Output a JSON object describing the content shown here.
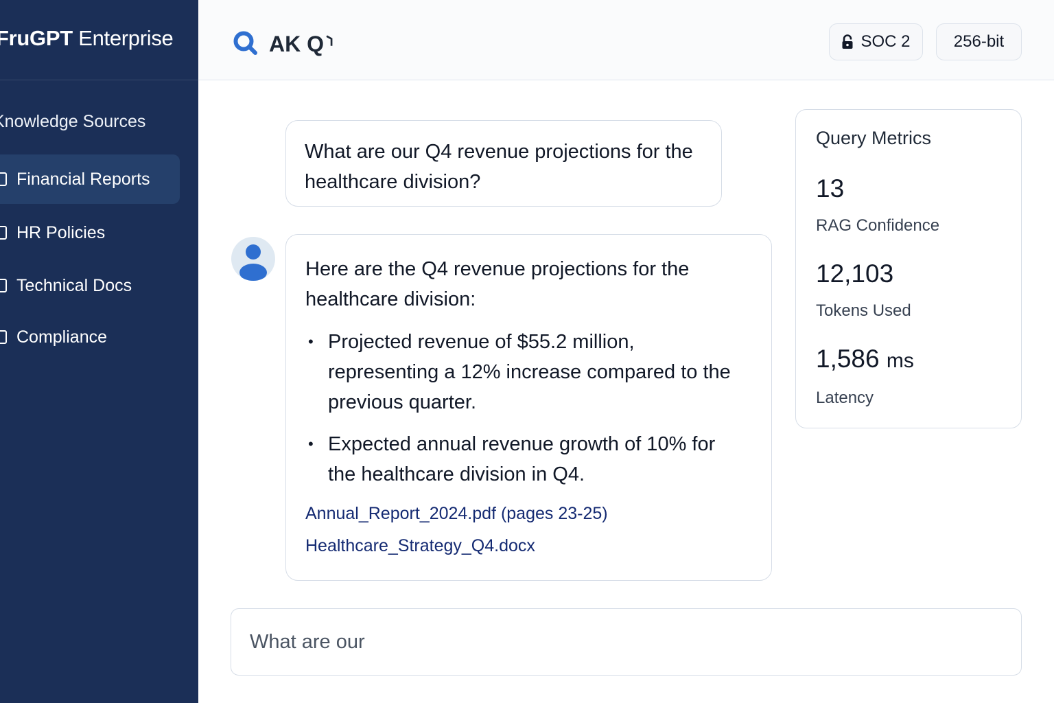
{
  "sidebar": {
    "brand_bold": "FruGPT",
    "brand_rest": " Enterprise",
    "section_title": "Knowledge Sources",
    "items": [
      {
        "label": "Financial Reports",
        "icon": "document-icon",
        "active": true
      },
      {
        "label": "HR Policies",
        "icon": "document-icon",
        "active": false
      },
      {
        "label": "Technical Docs",
        "icon": "document-icon",
        "active": false
      },
      {
        "label": "Compliance",
        "icon": "document-icon",
        "active": false
      }
    ]
  },
  "header": {
    "title": "AK Q⸃",
    "badges": [
      {
        "label": "SOC 2",
        "icon": "lock-icon"
      },
      {
        "label": "256-bit"
      }
    ]
  },
  "chat": {
    "user_message": "What are our Q4 revenue projections for the healthcare division?",
    "bot_intro": "Here are the Q4 revenue projections for the healthcare division:",
    "bot_bullets": [
      "Projected revenue of $55.2 million, representing a 12% increase compared to the previous quarter.",
      "Expected annual revenue growth of 10% for the healthcare division in Q4."
    ],
    "sources": [
      "Annual_Report_2024.pdf (pages 23-25)",
      "Healthcare_Strategy_Q4.docx"
    ]
  },
  "metrics": {
    "title": "Query Metrics",
    "items": [
      {
        "value": "13",
        "unit": "",
        "label": "RAG Confidence"
      },
      {
        "value": "12,103",
        "unit": "",
        "label": "Tokens Used"
      },
      {
        "value": "1,586",
        "unit": "ms",
        "label": "Latency"
      }
    ]
  },
  "input": {
    "value": "What are our"
  },
  "colors": {
    "sidebar_bg": "#1b2f57",
    "sidebar_active": "#25406b",
    "accent_blue": "#2f6fd0",
    "link": "#142a72"
  }
}
